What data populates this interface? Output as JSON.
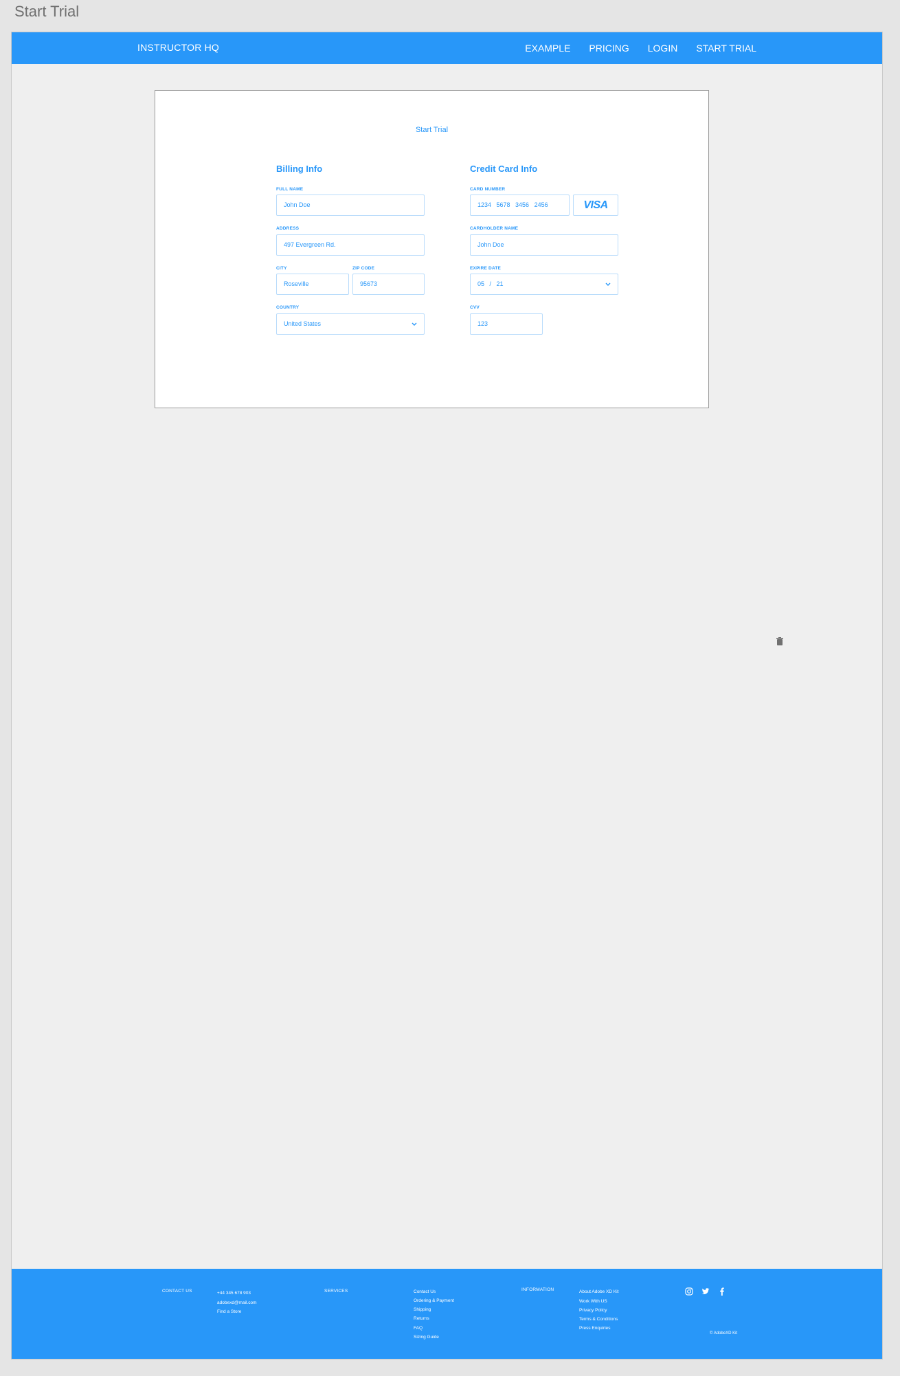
{
  "artboard_title": "Start Trial",
  "nav": {
    "brand": "INSTRUCTOR HQ",
    "links": [
      "EXAMPLE",
      "PRICING",
      "LOGIN",
      "START TRIAL"
    ]
  },
  "form": {
    "title": "Start Trial",
    "billing": {
      "heading": "Billing Info",
      "full_name_label": "FULL NAME",
      "full_name": "John Doe",
      "address_label": "ADDRESS",
      "address": "497 Evergreen Rd.",
      "city_label": "CITY",
      "city": "Roseville",
      "zip_label": "ZIP CODE",
      "zip": "95673",
      "country_label": "COUNTRY",
      "country": "United States"
    },
    "card": {
      "heading": "Credit Card Info",
      "number_label": "CARD NUMBER",
      "number": "1234   5678   3456   2456",
      "brand": "VISA",
      "holder_label": "CARDHOLDER NAME",
      "holder": "John Doe",
      "expire_label": "EXPIRE DATE",
      "expire": "05   /   21",
      "cvv_label": "CVV",
      "cvv": "123"
    }
  },
  "footer": {
    "contact_heading": "CONTACT US",
    "phone": "+44 345 678 903",
    "email": "adobexd@mail.com",
    "find_store": "Find a Store",
    "services_heading": "SERVICES",
    "services": [
      "Contact Us",
      "Ordering & Payment",
      "Shipping",
      "Returns",
      "FAQ",
      "Sizing Guide"
    ],
    "information_heading": "INFORMATION",
    "information": [
      "About Adobe XD Kit",
      "Work With US",
      "Privacy Policy",
      "Terms & Conditions",
      "Press Enquiries"
    ],
    "copyright": "© AdobeXD Kit"
  },
  "colors": {
    "brand_blue": "#2897f9",
    "field_border": "#b9dcfb",
    "canvas": "#efefef"
  },
  "icons": [
    "chevron-down-icon",
    "trash-icon",
    "instagram-icon",
    "twitter-icon",
    "facebook-icon"
  ]
}
